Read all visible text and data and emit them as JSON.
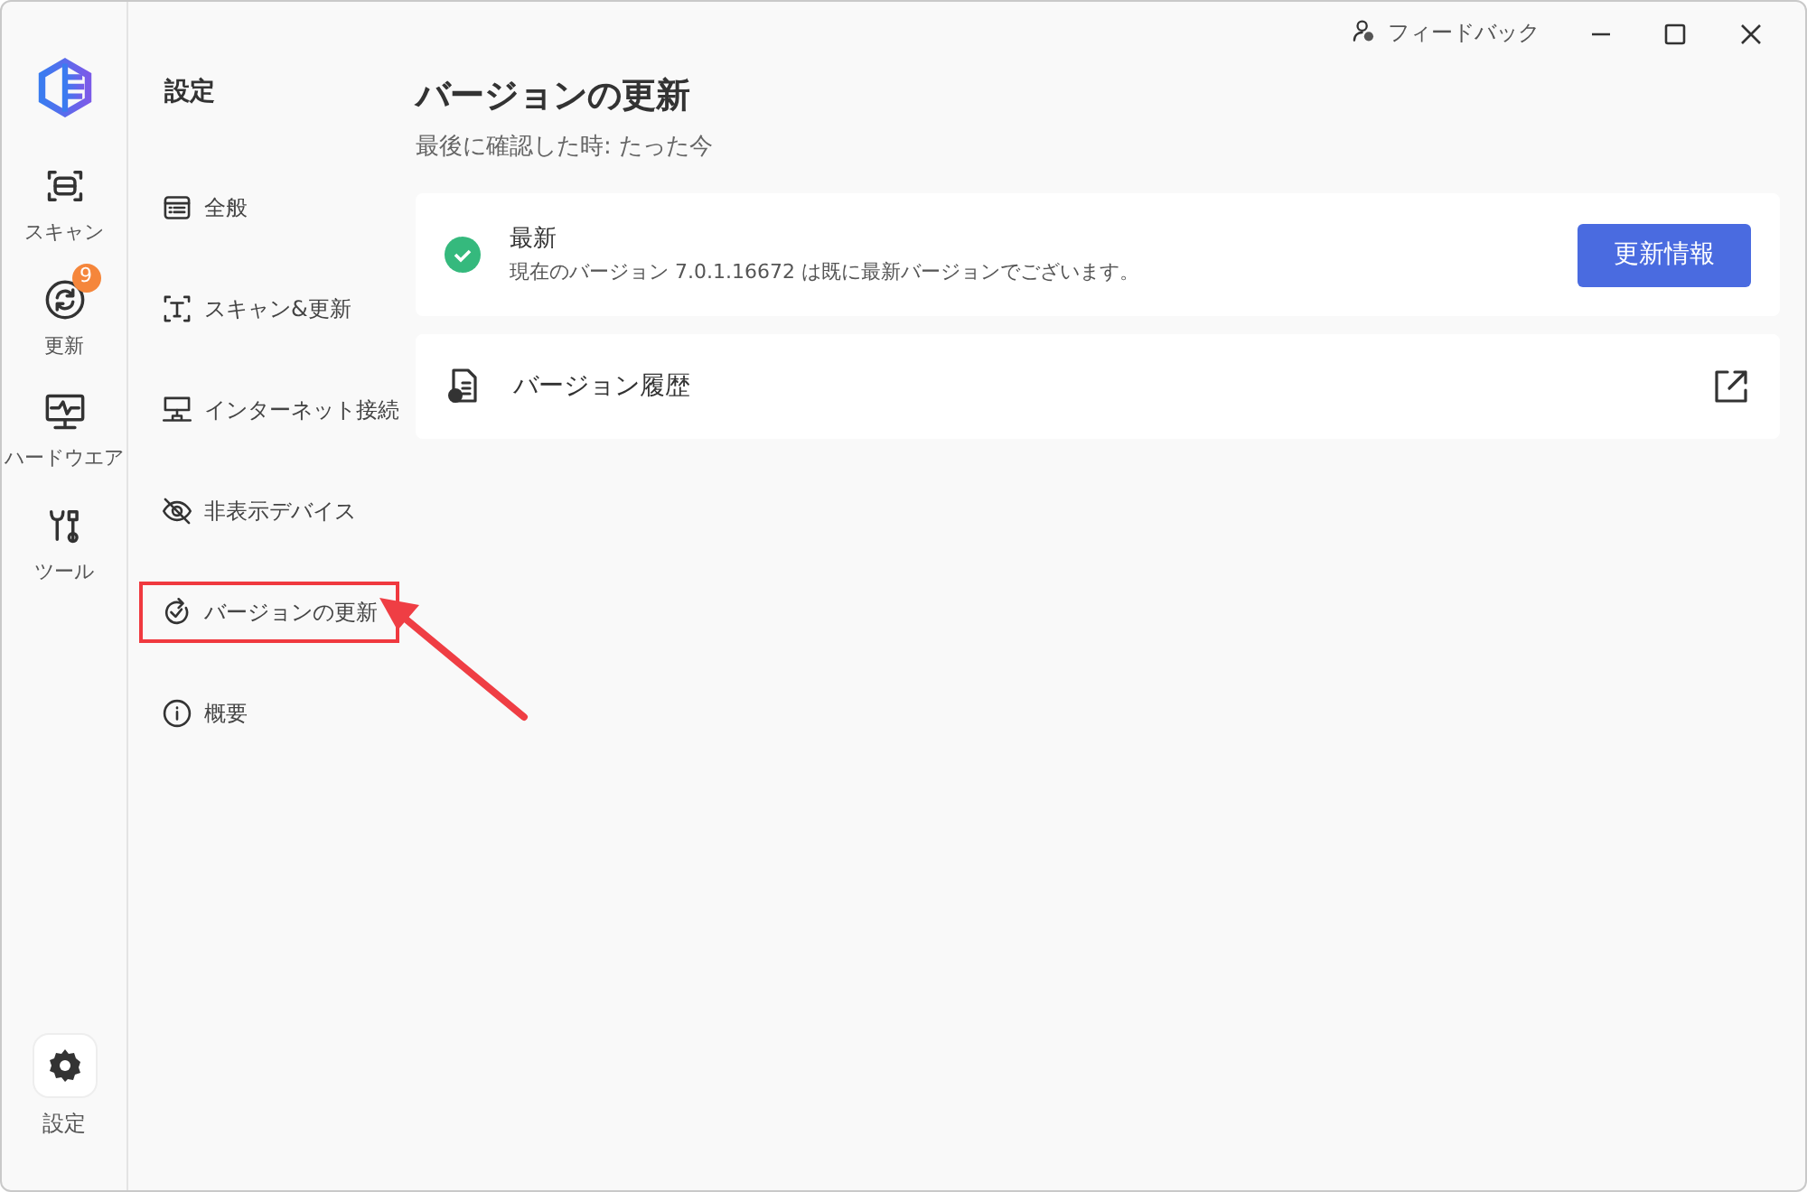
{
  "titlebar": {
    "feedback": "フィードバック"
  },
  "rail": {
    "items": [
      {
        "kind": "scan",
        "label": "スキャン"
      },
      {
        "kind": "update",
        "label": "更新",
        "badge": "9"
      },
      {
        "kind": "hardware",
        "label": "ハードウエア"
      },
      {
        "kind": "tools",
        "label": "ツール"
      }
    ],
    "settings": {
      "label": "設定",
      "selected": true
    }
  },
  "settings_menu": {
    "title": "設定",
    "items": [
      {
        "kind": "general",
        "label": "全般",
        "highlighted": false
      },
      {
        "kind": "scan",
        "label": "スキャン&更新",
        "highlighted": false
      },
      {
        "kind": "network",
        "label": "インターネット接続",
        "highlighted": false
      },
      {
        "kind": "hidden",
        "label": "非表示デバイス",
        "highlighted": false
      },
      {
        "kind": "version",
        "label": "バージョンの更新",
        "highlighted": true
      },
      {
        "kind": "about",
        "label": "概要",
        "highlighted": false
      }
    ]
  },
  "page": {
    "title": "バージョンの更新",
    "subtitle": "最後に確認した時: たった今",
    "status_card": {
      "title": "最新",
      "text": "現在のバージョン 7.0.1.16672 は既に最新バージョンでございます。",
      "button": "更新情報"
    },
    "history_card": {
      "label": "バージョン履歴"
    }
  },
  "annotations": [
    {
      "kind": "arrow"
    }
  ]
}
